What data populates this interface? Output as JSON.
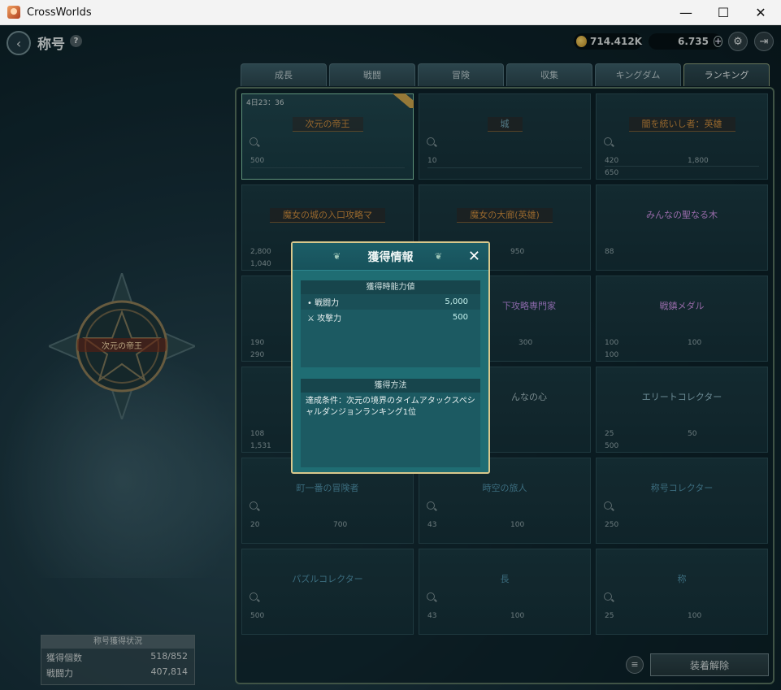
{
  "window": {
    "title": "CrossWorlds",
    "minimize": "—",
    "maximize": "☐",
    "close": "✕"
  },
  "header": {
    "back": "‹",
    "title": "称号",
    "help": "?",
    "coins": "714.412K",
    "gems": "6.735",
    "plus": "+"
  },
  "tabs": [
    "成長",
    "戦闘",
    "冒険",
    "収集",
    "キングダム",
    "ランキング"
  ],
  "emblem_label": "次元の帝王",
  "status": {
    "title": "称号獲得状況",
    "count_label": "獲得個数",
    "count_value": "518/852",
    "power_label": "戦闘力",
    "power_value": "407,814"
  },
  "cards": [
    {
      "name": "次元の帝王",
      "timer": "4日23：36",
      "stats": [
        "500",
        ""
      ]
    },
    {
      "name": "城",
      "stats": [
        "10",
        ""
      ]
    },
    {
      "name": "闇を統いし者：英雄",
      "stats": [
        "420",
        "1,800",
        "650"
      ]
    },
    {
      "name": "魔女の城の入口攻略マ",
      "stats": [
        "2,800",
        "",
        "1,040"
      ]
    },
    {
      "name": "魔女の大廊(英雄)",
      "stats": [
        "",
        "950"
      ]
    },
    {
      "name": "みんなの聖なる木",
      "stats": [
        "88",
        ""
      ]
    },
    {
      "name": "",
      "stats": [
        "190",
        "",
        "290"
      ]
    },
    {
      "name": "下攻略専門家",
      "stats": [
        "",
        "300"
      ]
    },
    {
      "name": "戦鎮メダル",
      "stats": [
        "100",
        "100",
        "100"
      ]
    },
    {
      "name": "",
      "stats": [
        "108",
        "",
        "1,531"
      ]
    },
    {
      "name": "んなの心",
      "stats": [
        "",
        ""
      ]
    },
    {
      "name": "エリートコレクター",
      "stats": [
        "25",
        "50",
        "500"
      ]
    },
    {
      "name": "町一番の冒険者",
      "stats": [
        "20",
        "700"
      ]
    },
    {
      "name": "時空の旅人",
      "stats": [
        "43",
        "100"
      ]
    },
    {
      "name": "称号コレクター",
      "stats": [
        "250",
        ""
      ]
    },
    {
      "name": "パズルコレクター",
      "stats": [
        "500",
        ""
      ]
    },
    {
      "name": "長",
      "stats": [
        "43",
        "100"
      ]
    },
    {
      "name": "称",
      "stats": [
        "25",
        "100"
      ]
    }
  ],
  "modal": {
    "title": "獲得情報",
    "close": "✕",
    "stats_header": "獲得時能力値",
    "stats": [
      {
        "label": "戦闘力",
        "value": "5,000"
      },
      {
        "label": "攻撃力",
        "value": "500"
      }
    ],
    "method_header": "獲得方法",
    "method_text": "達成条件：次元の境界のタイムアタックスペシャルダンジョンランキング1位"
  },
  "unequip": "装着解除"
}
